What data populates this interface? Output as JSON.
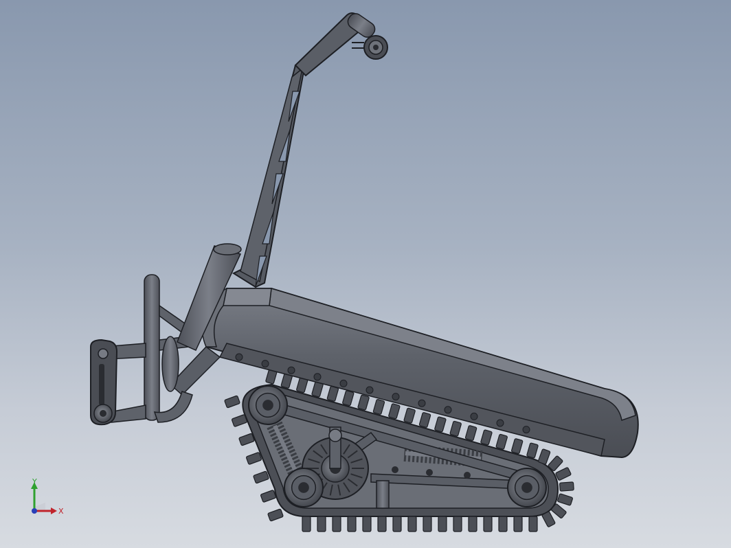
{
  "viewport": {
    "background_top": "#8998ae",
    "background_bottom": "#d7dbe1",
    "model_color": "#5c6068",
    "model_edge": "#1d1f24",
    "model_highlight": "#8c9099"
  },
  "triad": {
    "x_label": "X",
    "y_label": "Y",
    "x_color": "#c0242c",
    "y_color": "#2fa12f",
    "z_color": "#2a3fb8"
  },
  "model": {
    "track_cleat_count": 48,
    "track_wheels": 4,
    "components": [
      "handlebar-icon",
      "truss-mast-icon",
      "seat-platform-icon",
      "rear-frame-icon",
      "suspension-spring-icon",
      "drive-motor-icon",
      "track-wheel-icon",
      "crawler-track-icon"
    ]
  }
}
